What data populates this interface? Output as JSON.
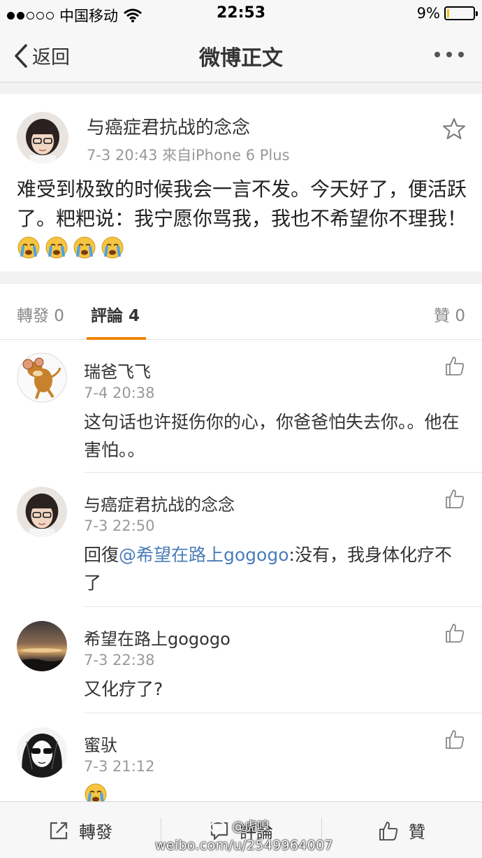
{
  "status_bar": {
    "carrier": "中国移动",
    "time": "22:53",
    "battery_text": "9%",
    "battery_level": 0.09
  },
  "nav": {
    "back_label": "返回",
    "title": "微博正文"
  },
  "post": {
    "author": "与癌症君抗战的念念",
    "meta": "7-3 20:43  來自iPhone 6 Plus",
    "text": "难受到极致的时候我会一言不发。今天好了，便活跃了。粑粑说：我宁愿你骂我，我也不希望你不理我！"
  },
  "tabs": {
    "repost": "轉發 0",
    "comment": "評論 4",
    "like": "贊 0"
  },
  "comments": [
    {
      "name": "瑞爸飞飞",
      "time": "7-4 20:38",
      "text": "这句话也许挺伤你的心，你爸爸怕失去你。。他在害怕。。"
    },
    {
      "name": "与癌症君抗战的念念",
      "time": "7-3 22:50",
      "reply_prefix": "回復",
      "mention": "@希望在路上gogogo",
      "text": ":没有，我身体化疗不了"
    },
    {
      "name": "希望在路上gogogo",
      "time": "7-3 22:38",
      "text": "又化疗了?"
    },
    {
      "name": "蜜驮",
      "time": "7-3 21:12",
      "text": ""
    }
  ],
  "toolbar": {
    "repost": "轉發",
    "comment": "評論",
    "like": "贊"
  },
  "watermark": {
    "handle": "@虎嗅",
    "url": "weibo.com/u/2549964007"
  },
  "colors": {
    "accent": "#f08300",
    "mention": "#4a7db8",
    "battery": "#f4c20d"
  }
}
